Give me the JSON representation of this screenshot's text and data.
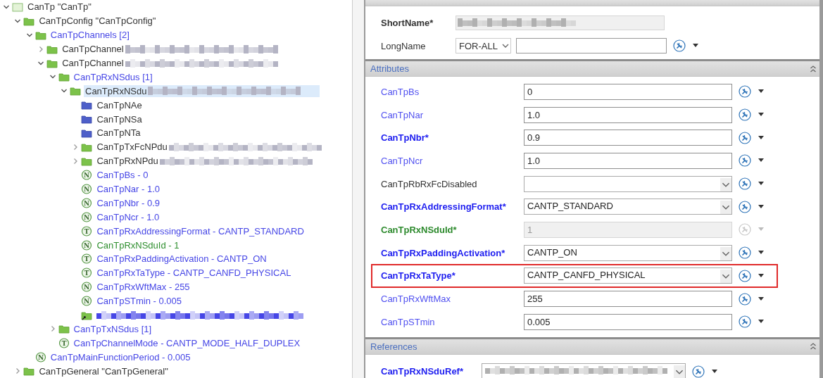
{
  "tree": [
    {
      "label": "CanTp \"CanTp\"",
      "kind": "module",
      "color": "#333333",
      "expanded": true,
      "selected": false,
      "children": [
        {
          "label": "CanTpConfig \"CanTpConfig\"",
          "kind": "container",
          "color": "#333333",
          "expanded": true,
          "selected": false,
          "children": [
            {
              "label": "CanTpChannels [2]",
              "kind": "container",
              "color": "#4646e6",
              "expanded": true,
              "selected": false,
              "children": [
                {
                  "label": "CanTpChannel",
                  "kind": "container",
                  "color": "#333333",
                  "expanded": false,
                  "selected": false,
                  "redacted": true
                },
                {
                  "label": "CanTpChannel",
                  "kind": "container",
                  "color": "#333333",
                  "expanded": true,
                  "selected": false,
                  "redacted": true,
                  "children": [
                    {
                      "label": "CanTpRxNSdus [1]",
                      "kind": "container",
                      "color": "#4646e6",
                      "expanded": true,
                      "selected": false,
                      "children": [
                        {
                          "label": "CanTpRxNSdu",
                          "kind": "container",
                          "color": "#333333",
                          "expanded": true,
                          "selected": true,
                          "redacted": true,
                          "children": [
                            {
                              "label": "CanTpNAe",
                              "kind": "param-folder",
                              "color": "#333333",
                              "selected": false
                            },
                            {
                              "label": "CanTpNSa",
                              "kind": "param-folder",
                              "color": "#333333",
                              "selected": false
                            },
                            {
                              "label": "CanTpNTa",
                              "kind": "param-folder",
                              "color": "#333333",
                              "selected": false
                            },
                            {
                              "label": "CanTpTxFcNPdu",
                              "kind": "container",
                              "color": "#333333",
                              "expanded": false,
                              "selected": false,
                              "redacted": true
                            },
                            {
                              "label": "CanTpRxNPdu",
                              "kind": "container",
                              "color": "#333333",
                              "expanded": false,
                              "selected": false,
                              "redacted": true
                            },
                            {
                              "label": "CanTpBs - 0",
                              "kind": "param",
                              "badge": "N",
                              "color": "#4646e6",
                              "selected": false
                            },
                            {
                              "label": "CanTpNar - 1.0",
                              "kind": "param",
                              "badge": "N",
                              "color": "#4646e6",
                              "selected": false
                            },
                            {
                              "label": "CanTpNbr - 0.9",
                              "kind": "param",
                              "badge": "N",
                              "color": "#4646e6",
                              "selected": false
                            },
                            {
                              "label": "CanTpNcr - 1.0",
                              "kind": "param",
                              "badge": "N",
                              "color": "#4646e6",
                              "selected": false
                            },
                            {
                              "label": "CanTpRxAddressingFormat - CANTP_STANDARD",
                              "kind": "param",
                              "badge": "T",
                              "color": "#4646e6",
                              "selected": false
                            },
                            {
                              "label": "CanTpRxNSduId - 1",
                              "kind": "param",
                              "badge": "N",
                              "color": "#2f8f2f",
                              "selected": false
                            },
                            {
                              "label": "CanTpRxPaddingActivation - CANTP_ON",
                              "kind": "param",
                              "badge": "T",
                              "color": "#4646e6",
                              "selected": false
                            },
                            {
                              "label": "CanTpRxTaType - CANTP_CANFD_PHYSICAL",
                              "kind": "param",
                              "badge": "T",
                              "color": "#4646e6",
                              "selected": false
                            },
                            {
                              "label": "CanTpRxWftMax - 255",
                              "kind": "param",
                              "badge": "N",
                              "color": "#4646e6",
                              "selected": false
                            },
                            {
                              "label": "CanTpSTmin - 0.005",
                              "kind": "param",
                              "badge": "N",
                              "color": "#4646e6",
                              "selected": false
                            },
                            {
                              "kind": "reference",
                              "color": "#4646e6",
                              "selected": false,
                              "redacted": true
                            }
                          ]
                        }
                      ]
                    },
                    {
                      "label": "CanTpTxNSdus [1]",
                      "kind": "container",
                      "color": "#4646e6",
                      "expanded": false,
                      "selected": false
                    },
                    {
                      "label": "CanTpChannelMode - CANTP_MODE_HALF_DUPLEX",
                      "kind": "param",
                      "badge": "T",
                      "color": "#4646e6",
                      "selected": false
                    }
                  ]
                }
              ]
            },
            {
              "label": "CanTpMainFunctionPeriod - 0.005",
              "kind": "param",
              "badge": "N",
              "color": "#4646e6",
              "selected": false
            }
          ]
        },
        {
          "label": "CanTpGeneral \"CanTpGeneral\"",
          "kind": "container",
          "color": "#333333",
          "expanded": false,
          "selected": false
        }
      ]
    }
  ],
  "general": {
    "short_name": {
      "label": "ShortName*",
      "disabled": true,
      "redacted": true
    },
    "long_name": {
      "label": "LongName",
      "language": "FOR-ALL"
    }
  },
  "attributes": {
    "title": "Attributes",
    "rows": [
      {
        "label": "CanTpBs",
        "required": false,
        "color": "#5050f0",
        "kind": "text",
        "value": "0",
        "disabled": false,
        "highlighted": false
      },
      {
        "label": "CanTpNar",
        "required": false,
        "color": "#5050f0",
        "kind": "text",
        "value": "1.0",
        "disabled": false,
        "highlighted": false
      },
      {
        "label": "CanTpNbr*",
        "required": true,
        "color": "#2020f0",
        "kind": "text",
        "value": "0.9",
        "disabled": false,
        "highlighted": false
      },
      {
        "label": "CanTpNcr",
        "required": false,
        "color": "#5050f0",
        "kind": "text",
        "value": "1.0",
        "disabled": false,
        "highlighted": false
      },
      {
        "label": "CanTpRbRxFcDisabled",
        "required": false,
        "color": "#333333",
        "kind": "combo",
        "disabled": false,
        "highlighted": false
      },
      {
        "label": "CanTpRxAddressingFormat*",
        "required": true,
        "color": "#2020f0",
        "kind": "combo",
        "value": "CANTP_STANDARD",
        "disabled": false,
        "highlighted": false
      },
      {
        "label": "CanTpRxNSduId*",
        "required": true,
        "color": "#2d8a2d",
        "kind": "text",
        "value": "1",
        "disabled": true,
        "highlighted": false
      },
      {
        "label": "CanTpRxPaddingActivation*",
        "required": true,
        "color": "#2020f0",
        "kind": "combo",
        "value": "CANTP_ON",
        "disabled": false,
        "highlighted": false
      },
      {
        "label": "CanTpRxTaType*",
        "required": true,
        "color": "#2020f0",
        "kind": "combo",
        "value": "CANTP_CANFD_PHYSICAL",
        "disabled": false,
        "highlighted": true
      },
      {
        "label": "CanTpRxWftMax",
        "required": false,
        "color": "#5050f0",
        "kind": "text",
        "value": "255",
        "disabled": false,
        "highlighted": false
      },
      {
        "label": "CanTpSTmin",
        "required": false,
        "color": "#5050f0",
        "kind": "text",
        "value": "0.005",
        "disabled": false,
        "highlighted": false
      }
    ]
  },
  "references": {
    "title": "References",
    "rows": [
      {
        "label": "CanTpRxNSduRef*",
        "required": true,
        "color": "#2020f0",
        "kind": "combo",
        "redacted": true
      }
    ]
  }
}
